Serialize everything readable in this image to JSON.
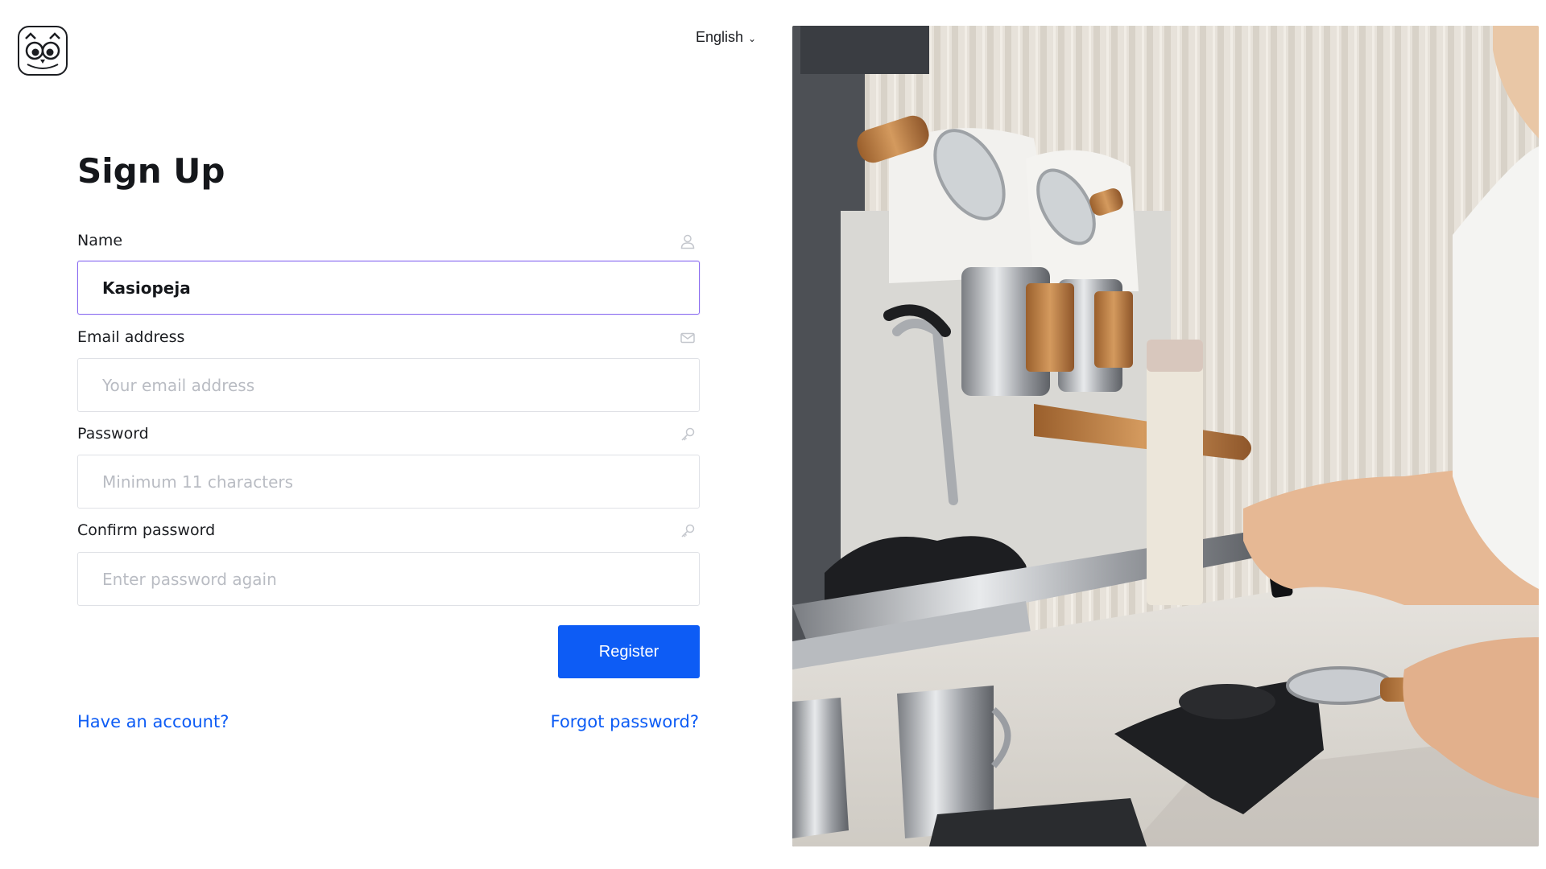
{
  "header": {
    "language": "English"
  },
  "form": {
    "title": "Sign Up",
    "fields": [
      {
        "label": "Name",
        "icon": "user-icon",
        "value": "Kasiopeja",
        "placeholder": ""
      },
      {
        "label": "Email address",
        "icon": "mail-icon",
        "value": "",
        "placeholder": "Your email address"
      },
      {
        "label": "Password",
        "icon": "key-icon",
        "value": "",
        "placeholder": "Minimum 11 characters"
      },
      {
        "label": "Confirm password",
        "icon": "key-icon",
        "value": "",
        "placeholder": "Enter password again"
      }
    ],
    "register_label": "Register",
    "have_account_label": "Have an account?",
    "forgot_password_label": "Forgot password?"
  },
  "colors": {
    "accent": "#0d5cf5",
    "focus_border": "#8a6cf0"
  }
}
